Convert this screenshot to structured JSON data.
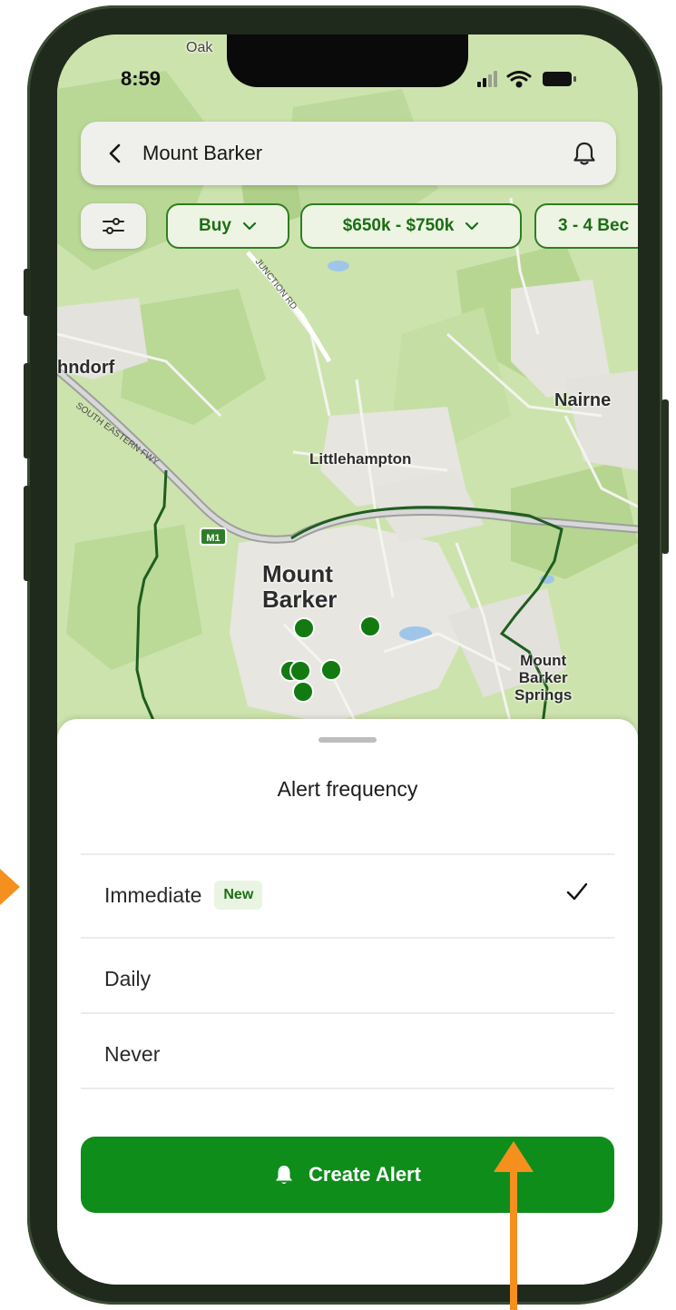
{
  "status_bar": {
    "time": "8:59"
  },
  "search": {
    "query": "Mount Barker"
  },
  "filters": {
    "chips": [
      {
        "label": "Buy"
      },
      {
        "label": "$650k - $750k"
      },
      {
        "label": "3 - 4 Bec"
      }
    ]
  },
  "map": {
    "labels": {
      "oakbank": "Oak",
      "hahndorf": "hndorf",
      "nairne": "Nairne",
      "littlehampton": "Littlehampton",
      "mount_barker_1": "Mount",
      "mount_barker_2": "Barker",
      "mb_springs_1": "Mount",
      "mb_springs_2": "Barker",
      "mb_springs_3": "Springs",
      "junction_rd": "JUNCTION RD",
      "freeway": "SOUTH EASTERN FWY",
      "m1_shield": "M1"
    },
    "accent": "#1a7a1a"
  },
  "sheet": {
    "title": "Alert frequency",
    "options": [
      {
        "label": "Immediate",
        "badge": "New",
        "selected": true
      },
      {
        "label": "Daily",
        "selected": false
      },
      {
        "label": "Never",
        "selected": false
      }
    ],
    "create_button": "Create Alert"
  },
  "colors": {
    "primary_green": "#0e8d1b",
    "annotation_orange": "#f5901e"
  }
}
